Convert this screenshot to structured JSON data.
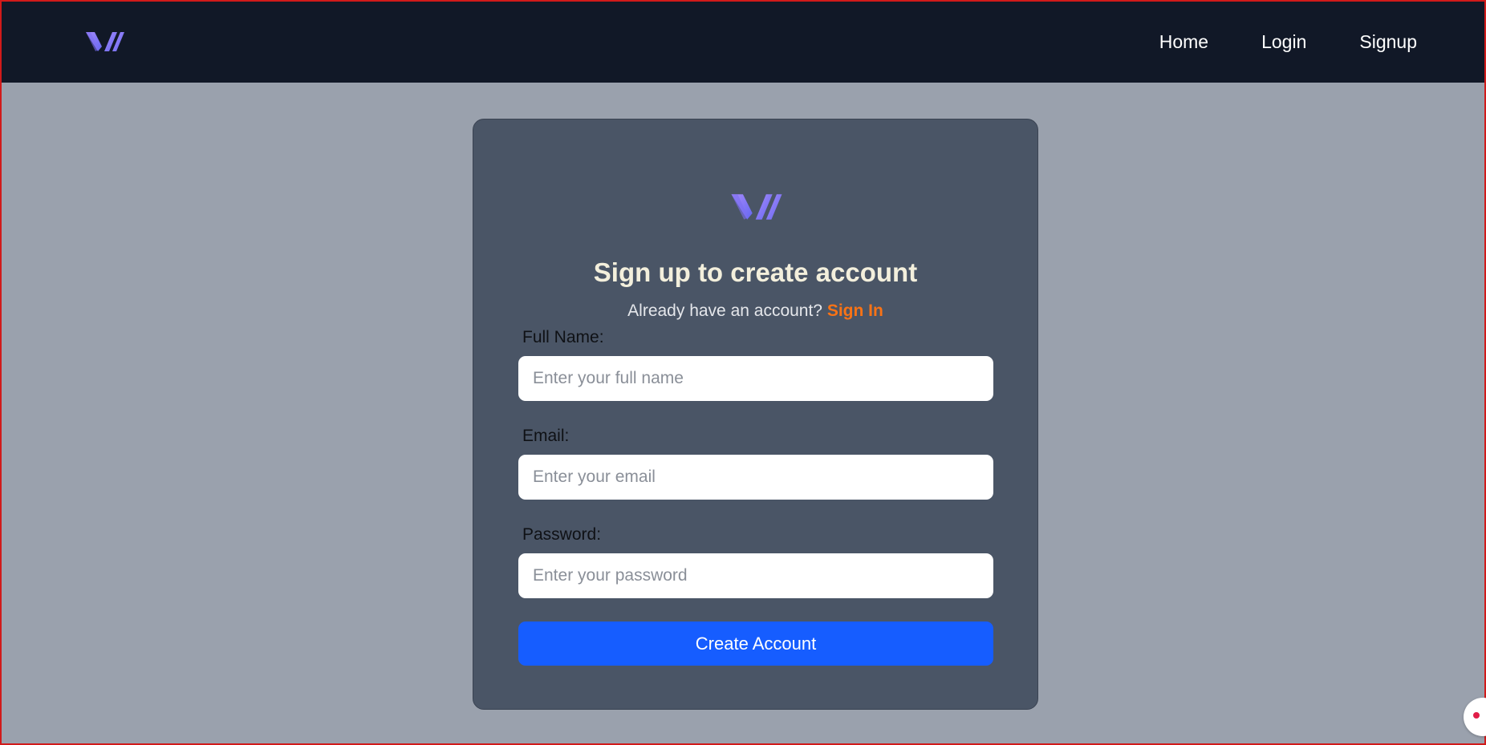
{
  "nav": {
    "logo": "logo-icon",
    "links": [
      "Home",
      "Login",
      "Signup"
    ]
  },
  "card": {
    "logo": "logo-icon",
    "title": "Sign up to create account",
    "signin_prompt": "Already have an account?",
    "signin_link": "Sign In",
    "fields": {
      "full_name": {
        "label": "Full Name:",
        "value": "",
        "placeholder": "Enter your full name"
      },
      "email": {
        "label": "Email:",
        "value": "",
        "placeholder": "Enter your email"
      },
      "password": {
        "label": "Password:",
        "value": "",
        "placeholder": "Enter your password"
      }
    },
    "submit_label": "Create Account"
  },
  "colors": {
    "navbar": "#111827",
    "page_background": "#9aa1ad",
    "card": "#4a5566",
    "title": "#f3efdc",
    "accent_link": "#f97316",
    "primary_button": "#165dff",
    "logo_gradient": [
      "#a78bfa",
      "#6366f1"
    ]
  }
}
